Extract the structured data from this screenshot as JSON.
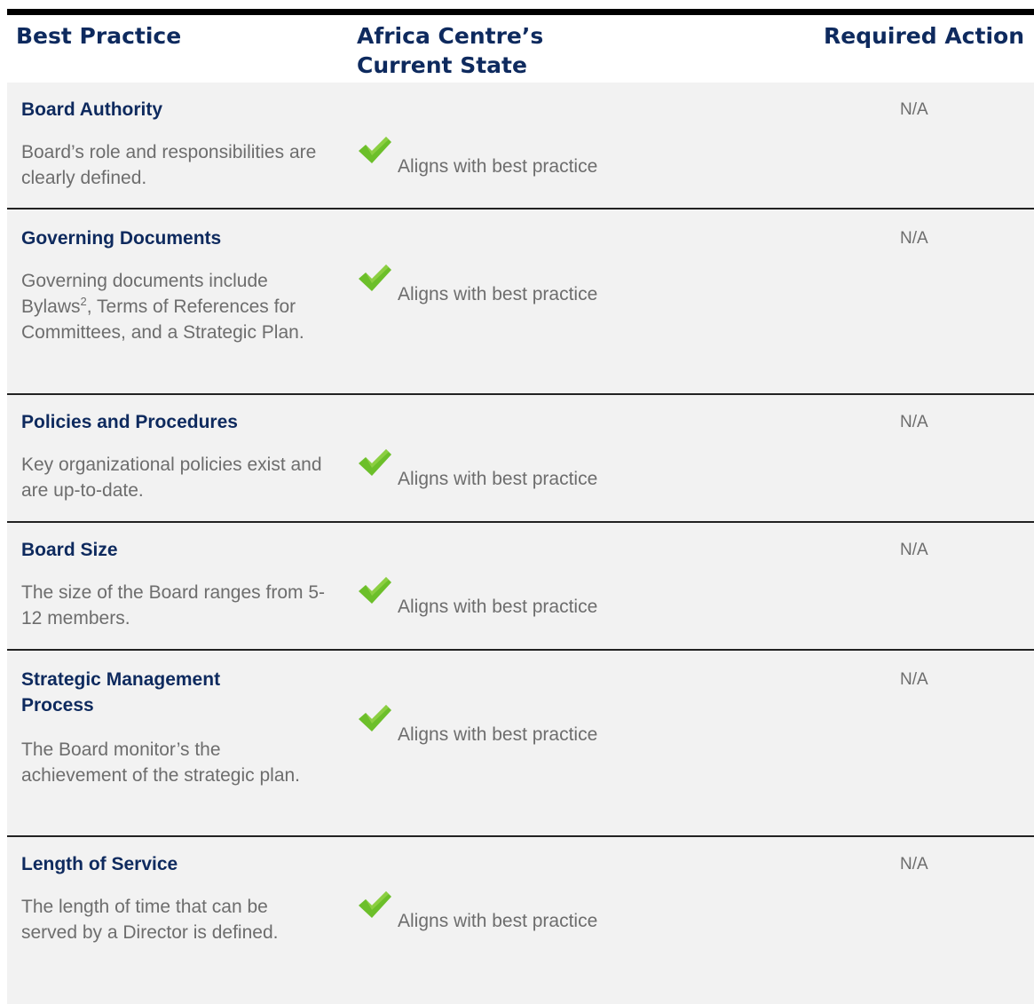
{
  "header": {
    "best_practice": "Best Practice",
    "current_state_line1": "Africa Centre’s",
    "current_state_line2": "Current State",
    "required_action": "Required Action"
  },
  "status_icon": "check-icon",
  "colors": {
    "heading": "#0e2a5e",
    "body_text": "#6d6d6d",
    "row_bg": "#f2f2f2",
    "check_green": "#6cbf2a"
  },
  "rows": [
    {
      "title": "Board Authority",
      "description": "Board’s role and responsibilities are clearly defined.",
      "status": "Aligns with best practice",
      "action": "N/A"
    },
    {
      "title": "Governing Documents",
      "description_pre": "Governing documents include Bylaws",
      "description_sup": "2",
      "description_post": ", Terms of References for Committees, and a Strategic Plan.",
      "status": "Aligns with best practice",
      "action": "N/A"
    },
    {
      "title": "Policies and Procedures",
      "description": "Key organizational policies exist and are up-to-date.",
      "status": "Aligns with best practice",
      "action": "N/A"
    },
    {
      "title": "Board Size",
      "description": "The size of the Board ranges from 5-12 members.",
      "status": "Aligns with best practice",
      "action": "N/A"
    },
    {
      "title": "Strategic Management Process",
      "description": "The Board monitor’s the achievement of the strategic plan.",
      "status": "Aligns with best practice",
      "action": "N/A"
    },
    {
      "title": "Length of Service",
      "description": "The length of time that can be served by a Director is defined.",
      "status": "Aligns with best practice",
      "action": "N/A"
    }
  ]
}
